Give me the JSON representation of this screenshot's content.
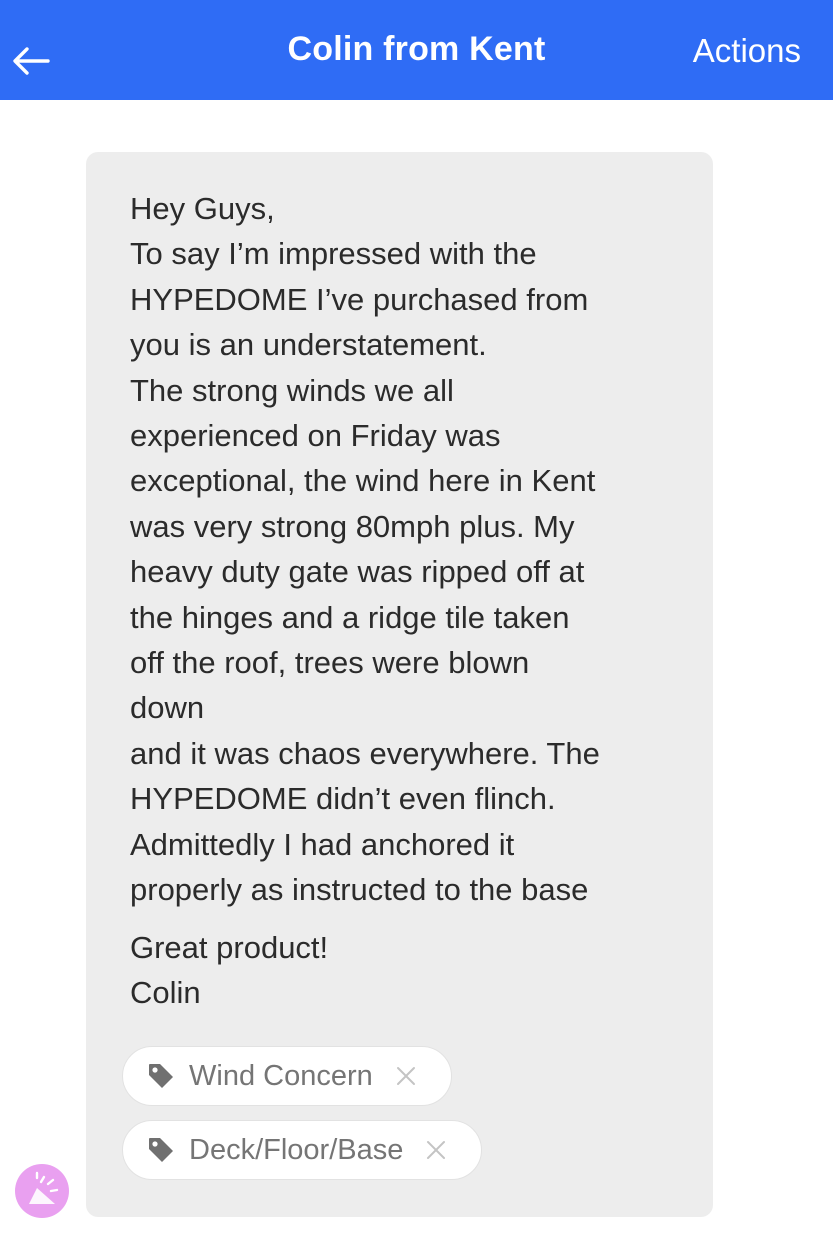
{
  "header": {
    "title": "Colin from Kent",
    "actions_label": "Actions",
    "back_icon": "back-arrow-icon",
    "background": "#2f6cf5"
  },
  "message": {
    "lines": [
      "Hey Guys,",
      "To say I’m impressed with the",
      "HYPEDOME I’ve purchased from",
      "you is an understatement.",
      "The strong winds we all",
      "experienced on Friday was",
      "exceptional, the wind here in Kent",
      "was very strong 80mph plus. My",
      "heavy duty gate was ripped off at",
      "the hinges and a ridge tile taken",
      "off the roof, trees were blown",
      "down",
      "and it was chaos everywhere. The",
      "HYPEDOME didn’t even flinch.",
      "Admittedly I had anchored it",
      "properly as instructed to the base"
    ],
    "closing": [
      "Great product!",
      "Colin"
    ]
  },
  "tags": [
    {
      "label": "Wind Concern",
      "icon": "tag-icon",
      "remove_icon": "close-icon"
    },
    {
      "label": "Deck/Floor/Base",
      "icon": "tag-icon",
      "remove_icon": "close-icon"
    }
  ],
  "fab": {
    "icon": "celebration-icon",
    "color": "#e9a0f0"
  }
}
